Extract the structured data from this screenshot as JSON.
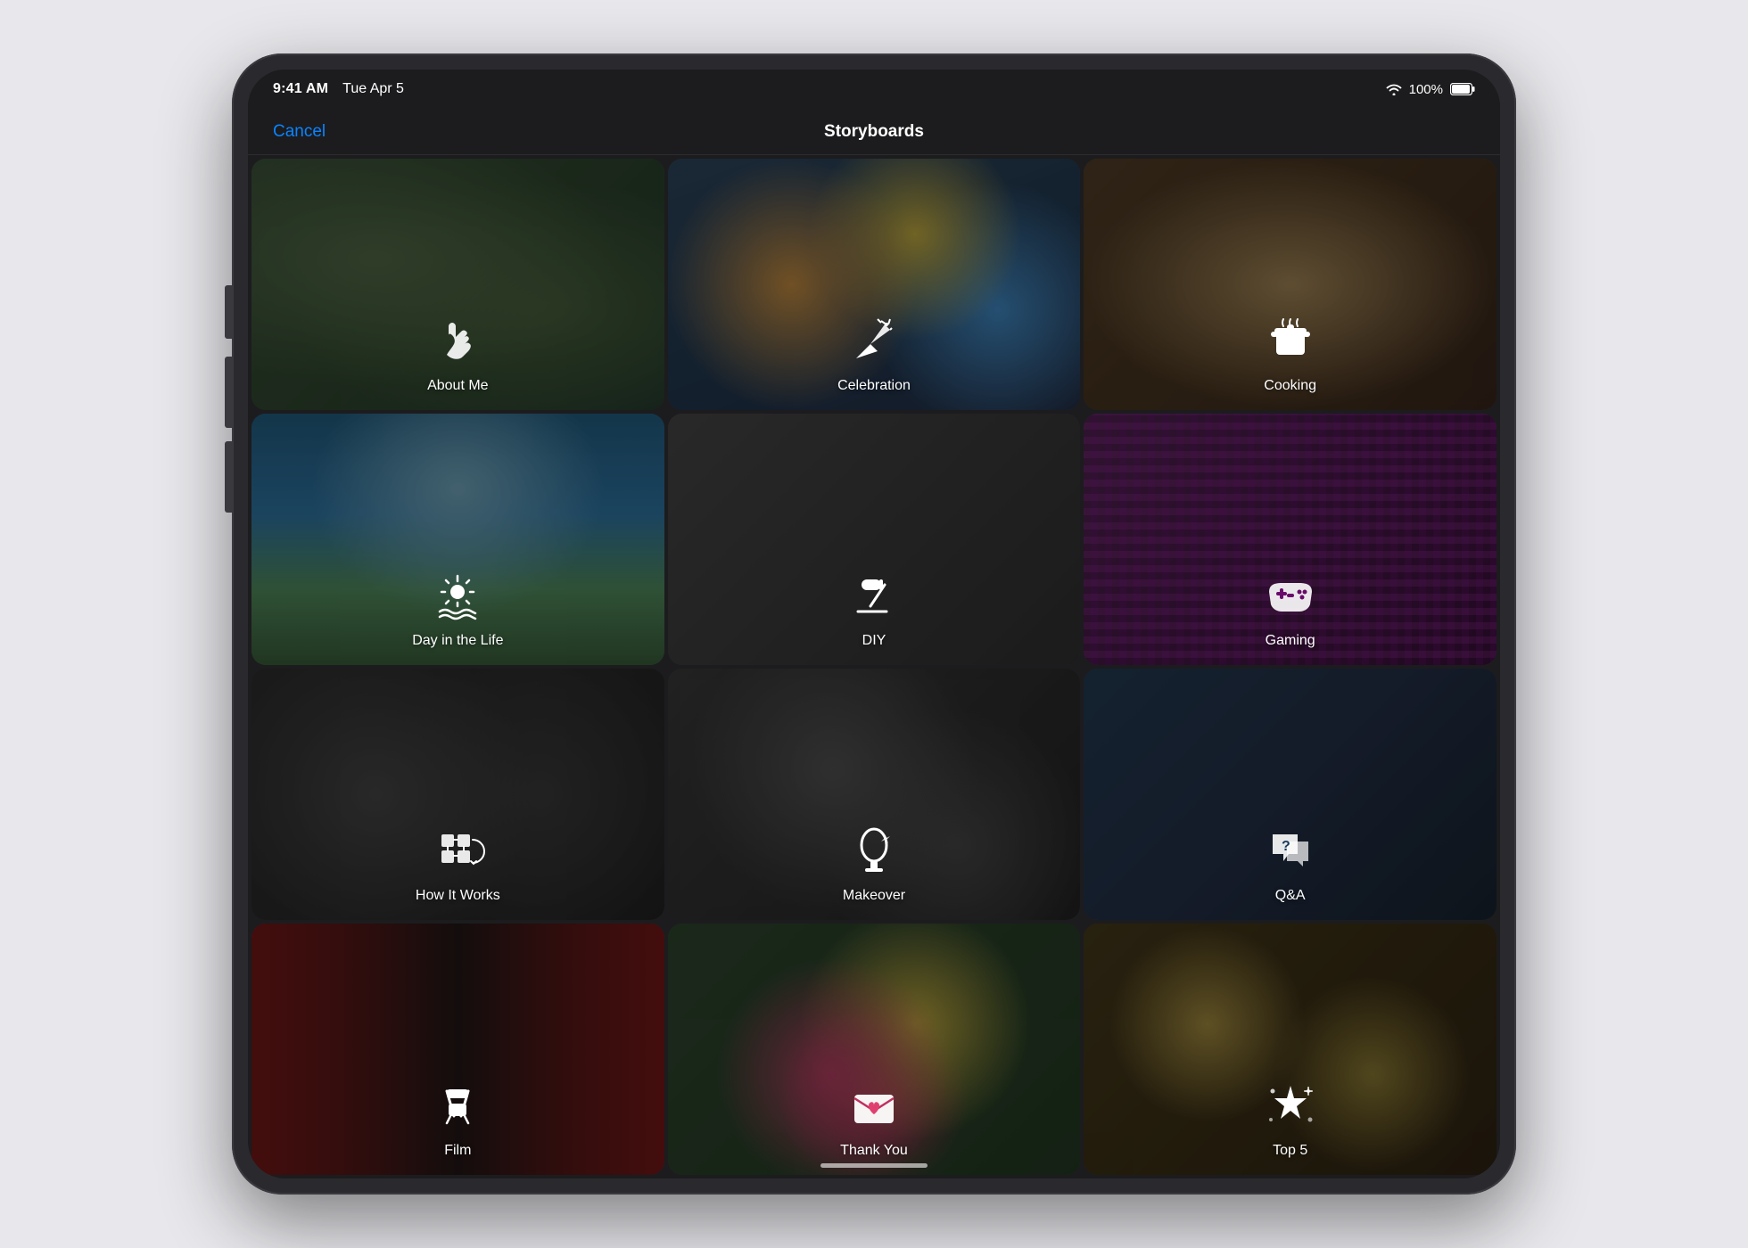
{
  "device": {
    "statusBar": {
      "time": "9:41 AM",
      "date": "Tue Apr 5",
      "wifi": "WiFi",
      "batteryPct": "100%",
      "batteryFull": true
    },
    "navBar": {
      "cancel": "Cancel",
      "title": "Storyboards"
    }
  },
  "grid": {
    "items": [
      {
        "id": "about-me",
        "label": "About Me",
        "icon": "wave",
        "bgClass": "bg-desk"
      },
      {
        "id": "celebration",
        "label": "Celebration",
        "icon": "party",
        "bgClass": "bg-balloons"
      },
      {
        "id": "cooking",
        "label": "Cooking",
        "icon": "pot",
        "bgClass": "bg-food"
      },
      {
        "id": "day-in-life",
        "label": "Day in the Life",
        "icon": "sun",
        "bgClass": "bg-sky"
      },
      {
        "id": "diy",
        "label": "DIY",
        "icon": "roller",
        "bgClass": "bg-tools"
      },
      {
        "id": "gaming",
        "label": "Gaming",
        "icon": "gamepad",
        "bgClass": "bg-purple-pixels"
      },
      {
        "id": "how-it-works",
        "label": "How It Works",
        "icon": "gears",
        "bgClass": "bg-gears"
      },
      {
        "id": "makeover",
        "label": "Makeover",
        "icon": "mirror",
        "bgClass": "bg-mirror"
      },
      {
        "id": "qa",
        "label": "Q&A",
        "icon": "qa",
        "bgClass": "bg-mics"
      },
      {
        "id": "film",
        "label": "Film",
        "icon": "film",
        "bgClass": "bg-curtains"
      },
      {
        "id": "thank-you",
        "label": "Thank You",
        "icon": "envelope",
        "bgClass": "bg-flowers"
      },
      {
        "id": "top5",
        "label": "Top 5",
        "icon": "star",
        "bgClass": "bg-stars"
      }
    ]
  }
}
